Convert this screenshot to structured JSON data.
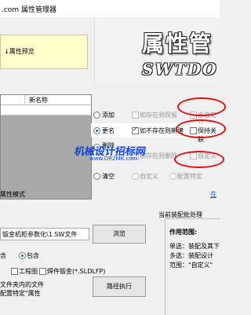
{
  "window": {
    "title": ".com 属性管理器"
  },
  "banner": {
    "preview_label": "↓属性预览",
    "brand_title": "属性管",
    "brand_subtitle": "SWTDO"
  },
  "grid": {
    "column_header": "新名称"
  },
  "options": {
    "add_label": "添加",
    "rename_label": "更名",
    "delete_label": "删除",
    "clear_label": "清空",
    "mode_label": "属性模式",
    "exists_keep": "如存在则保留",
    "contains_custom": "含自定义",
    "not_exists_add": "如不存在则新建",
    "keep_value": "保持关联",
    "exists_delete": "如存在则删除",
    "custom": "自定义",
    "config_specific": "配置特定",
    "in_label": "在",
    "rename_checked": true,
    "not_exists_checked": true
  },
  "watermark": {
    "text": "机械设计招标网",
    "url": "www.DR2MK.com"
  },
  "files": {
    "path_value": "钣金机柜参数化\\1.SW文件",
    "browse_label": "浏览",
    "include_label": "含",
    "contains_label": "包含",
    "contains_checked": true,
    "drawing_label": "工程图",
    "weldment_label": "焊件钣金(*.SLDLFP)",
    "note_line1": "文件夹内的文件",
    "note_line2": "配置特定\"属性",
    "execute_label": "路径执行"
  },
  "config_panel": {
    "title": "当前装配批处理",
    "scope_label": "作用范围:",
    "single_line": "单选：装配及其下",
    "multi_line": "多选：装配设计",
    "note_line": "范围：\"自定义\""
  }
}
